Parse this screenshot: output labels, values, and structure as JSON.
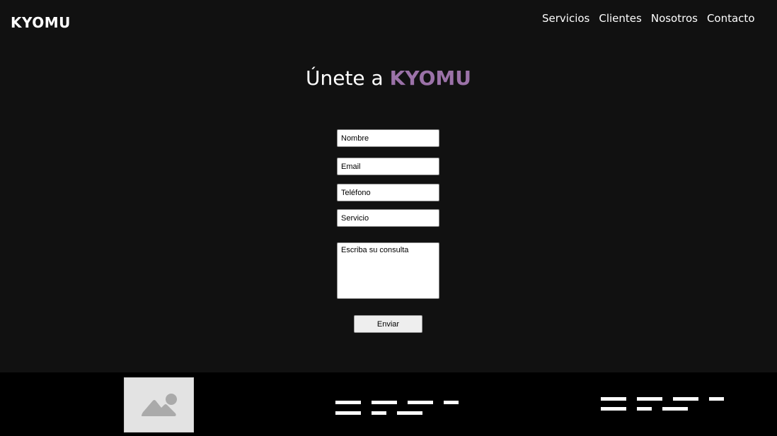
{
  "header": {
    "logo": "KYOMU",
    "nav": [
      "Servicios",
      "Clientes",
      "Nosotros",
      "Contacto"
    ]
  },
  "hero": {
    "title_prefix": "Únete a ",
    "title_brand": "KYOMU"
  },
  "form": {
    "name_placeholder": "Nombre",
    "email_placeholder": "Email",
    "phone_placeholder": "Teléfono",
    "service_placeholder": "Servicio",
    "message_placeholder": "Escriba su consulta",
    "submit_label": "Enviar"
  },
  "footer": {
    "logo_image_icon": "image-placeholder-icon"
  },
  "colors": {
    "background": "#111111",
    "brand_accent": "#9b72a8",
    "footer": "#000000"
  }
}
